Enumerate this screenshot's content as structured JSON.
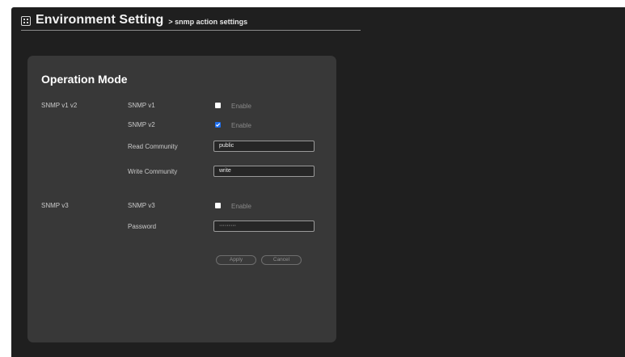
{
  "header": {
    "title": "Environment Setting",
    "subtitle": "> snmp action settings"
  },
  "panel": {
    "title": "Operation Mode",
    "sections": {
      "v1v2": {
        "label": "SNMP v1 v2",
        "snmp_v1": {
          "label": "SNMP v1",
          "checked": false,
          "option": "Enable"
        },
        "snmp_v2": {
          "label": "SNMP v2",
          "checked": true,
          "option": "Enable"
        },
        "read_community": {
          "label": "Read Community",
          "value": "public"
        },
        "write_community": {
          "label": "Write Community",
          "value": "write"
        }
      },
      "v3": {
        "label": "SNMP v3",
        "snmp_v3": {
          "label": "SNMP v3",
          "checked": false,
          "option": "Enable"
        },
        "password": {
          "label": "Password",
          "value": "·········"
        }
      }
    },
    "buttons": {
      "apply": "Apply",
      "cancel": "Cancel"
    }
  },
  "colors": {
    "background": "#1f1f1f",
    "panel": "#383838",
    "checkbox_checked": "#1e6ff0"
  }
}
